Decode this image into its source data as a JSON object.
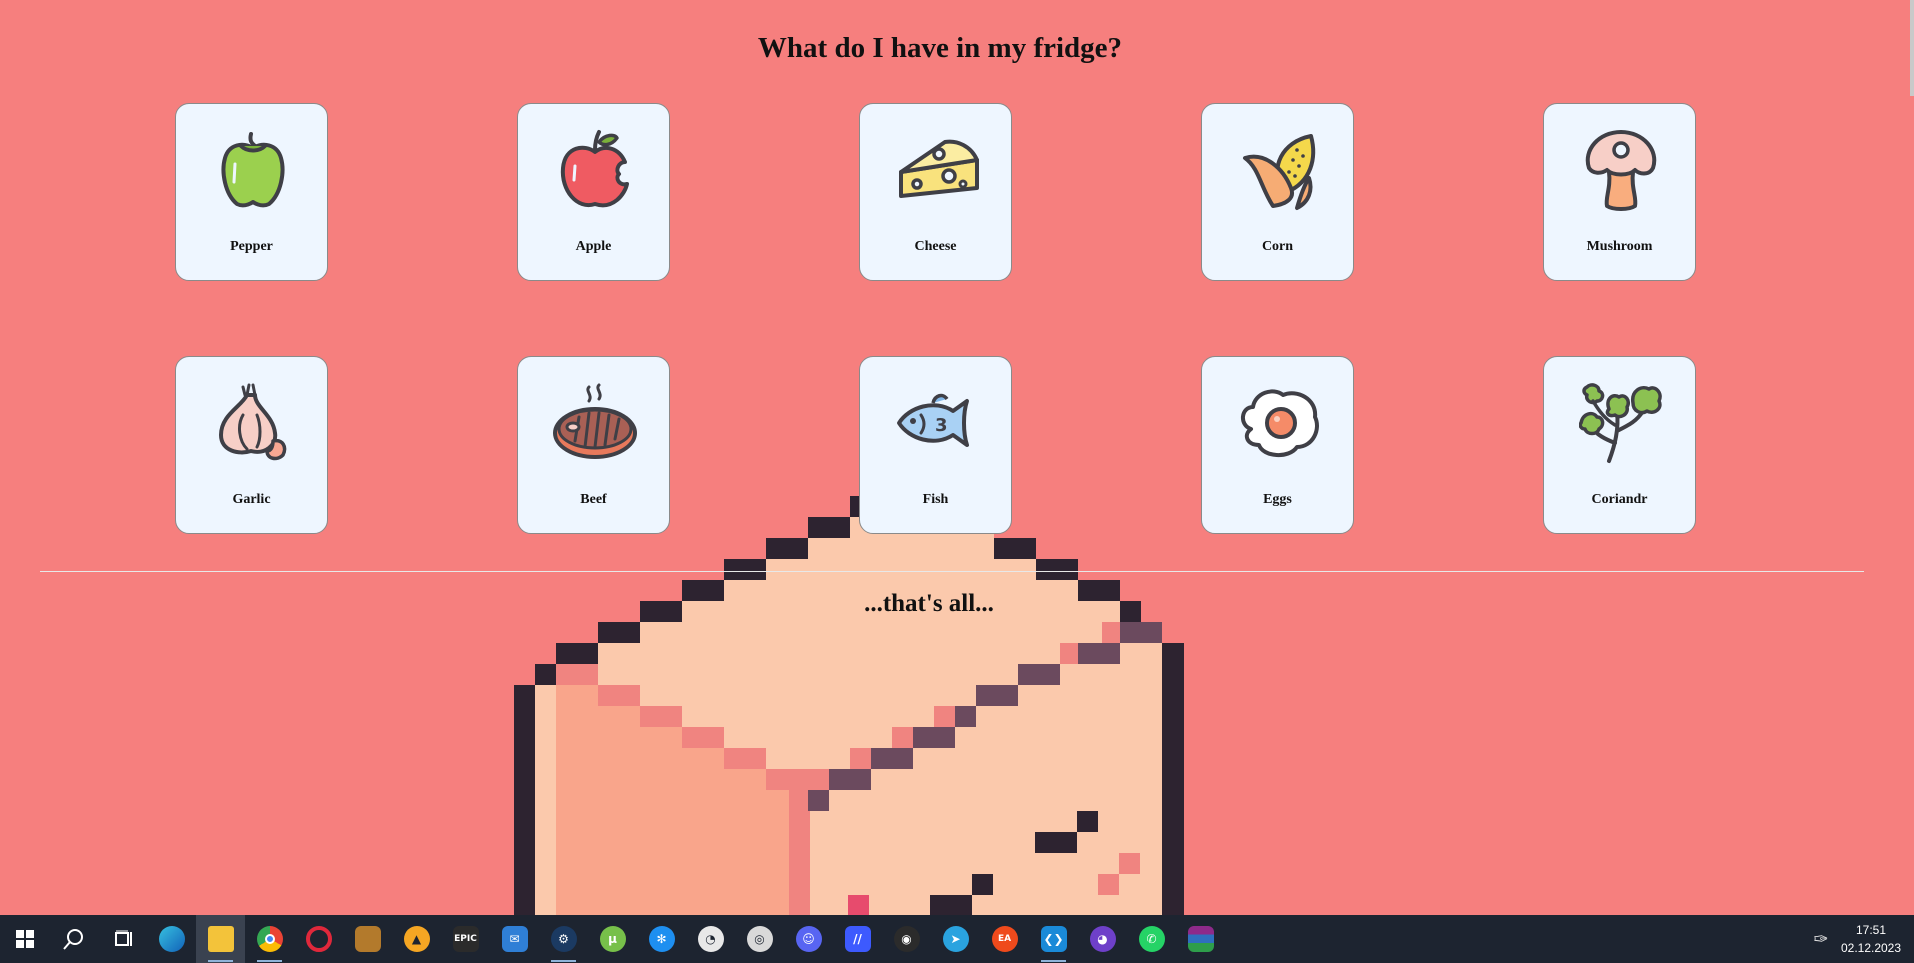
{
  "page": {
    "title": "What do I have in my fridge?",
    "footer": "...that's all..."
  },
  "items": [
    {
      "label": "Pepper",
      "icon": "pepper-icon"
    },
    {
      "label": "Apple",
      "icon": "apple-icon"
    },
    {
      "label": "Cheese",
      "icon": "cheese-icon"
    },
    {
      "label": "Corn",
      "icon": "corn-icon"
    },
    {
      "label": "Mushroom",
      "icon": "mushroom-icon"
    },
    {
      "label": "Garlic",
      "icon": "garlic-icon"
    },
    {
      "label": "Beef",
      "icon": "beef-icon"
    },
    {
      "label": "Fish",
      "icon": "fish-icon"
    },
    {
      "label": "Eggs",
      "icon": "eggs-icon"
    },
    {
      "label": "Coriandr",
      "icon": "coriander-icon"
    }
  ],
  "colors": {
    "background": "#f67f7e",
    "card": "#eef6ff",
    "taskbar": "#1d2430"
  },
  "taskbar": {
    "apps": [
      "start-icon",
      "search-icon",
      "task-view-icon",
      "edge-icon",
      "file-explorer-icon",
      "chrome-icon",
      "opera-icon",
      "app-icon",
      "aimp-icon",
      "epic-games-icon",
      "mail-icon",
      "steam-icon",
      "utorrent-icon",
      "battlenet-icon",
      "app-icon",
      "app-icon",
      "discord-icon",
      "app-icon",
      "app-icon",
      "telegram-icon",
      "ea-icon",
      "vscode-icon",
      "github-icon",
      "whatsapp-icon",
      "winrar-icon"
    ],
    "epic_label": "EPIC",
    "ea_label": "EA",
    "time": "17:51",
    "date": "02.12.2023"
  }
}
